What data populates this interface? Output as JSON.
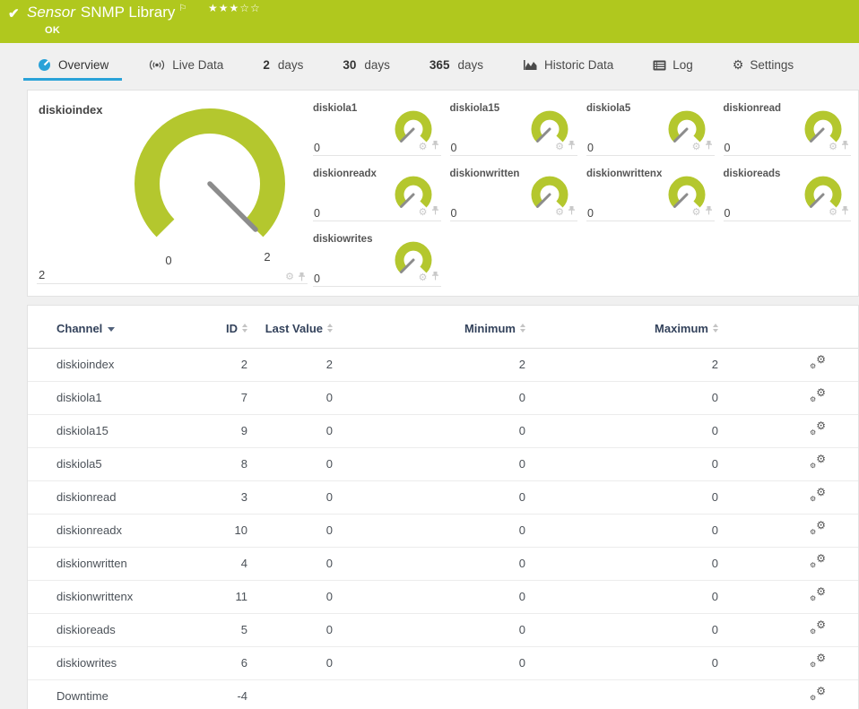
{
  "header": {
    "kind": "Sensor",
    "title": "SNMP Library",
    "status": "OK",
    "rating_filled": "★★★",
    "rating_empty": "☆☆",
    "flag_icon": "⚐",
    "check_icon": "✔"
  },
  "tabs": [
    {
      "id": "overview",
      "label": "Overview",
      "icon": "gauge-icon",
      "active": true
    },
    {
      "id": "live-data",
      "label": "Live Data",
      "icon": "broadcast-icon"
    },
    {
      "id": "2-days",
      "num": "2",
      "label": "days"
    },
    {
      "id": "30-days",
      "num": "30",
      "label": "days"
    },
    {
      "id": "365-days",
      "num": "365",
      "label": "days"
    },
    {
      "id": "historic-data",
      "label": "Historic Data",
      "icon": "area-chart-icon"
    },
    {
      "id": "log",
      "label": "Log",
      "icon": "log-icon"
    },
    {
      "id": "settings",
      "label": "Settings",
      "icon": "gear-icon"
    }
  ],
  "gauges": {
    "primary": {
      "name": "diskioindex",
      "value": "2",
      "scale_min": "0",
      "scale_max": "2"
    },
    "small": [
      {
        "name": "diskiola1",
        "value": "0"
      },
      {
        "name": "diskiola15",
        "value": "0"
      },
      {
        "name": "diskiola5",
        "value": "0"
      },
      {
        "name": "diskionread",
        "value": "0"
      },
      {
        "name": "diskionreadx",
        "value": "0"
      },
      {
        "name": "diskionwritten",
        "value": "0"
      },
      {
        "name": "diskionwrittenx",
        "value": "0"
      },
      {
        "name": "diskioreads",
        "value": "0"
      },
      {
        "name": "diskiowrites",
        "value": "0"
      }
    ]
  },
  "table": {
    "headers": {
      "channel": "Channel",
      "id": "ID",
      "last": "Last Value",
      "min": "Minimum",
      "max": "Maximum"
    },
    "rows": [
      {
        "channel": "diskioindex",
        "id": "2",
        "last": "2",
        "min": "2",
        "max": "2"
      },
      {
        "channel": "diskiola1",
        "id": "7",
        "last": "0",
        "min": "0",
        "max": "0"
      },
      {
        "channel": "diskiola15",
        "id": "9",
        "last": "0",
        "min": "0",
        "max": "0"
      },
      {
        "channel": "diskiola5",
        "id": "8",
        "last": "0",
        "min": "0",
        "max": "0"
      },
      {
        "channel": "diskionread",
        "id": "3",
        "last": "0",
        "min": "0",
        "max": "0"
      },
      {
        "channel": "diskionreadx",
        "id": "10",
        "last": "0",
        "min": "0",
        "max": "0"
      },
      {
        "channel": "diskionwritten",
        "id": "4",
        "last": "0",
        "min": "0",
        "max": "0"
      },
      {
        "channel": "diskionwrittenx",
        "id": "11",
        "last": "0",
        "min": "0",
        "max": "0"
      },
      {
        "channel": "diskioreads",
        "id": "5",
        "last": "0",
        "min": "0",
        "max": "0"
      },
      {
        "channel": "diskiowrites",
        "id": "6",
        "last": "0",
        "min": "0",
        "max": "0"
      },
      {
        "channel": "Downtime",
        "id": "-4",
        "last": "",
        "min": "",
        "max": ""
      }
    ]
  },
  "colors": {
    "brand_green": "#b0c81e",
    "gauge_green": "#b4c72e",
    "accent_blue": "#2aa2d8",
    "table_header_text": "#33425b",
    "needle_gray": "#8c8c8c"
  }
}
